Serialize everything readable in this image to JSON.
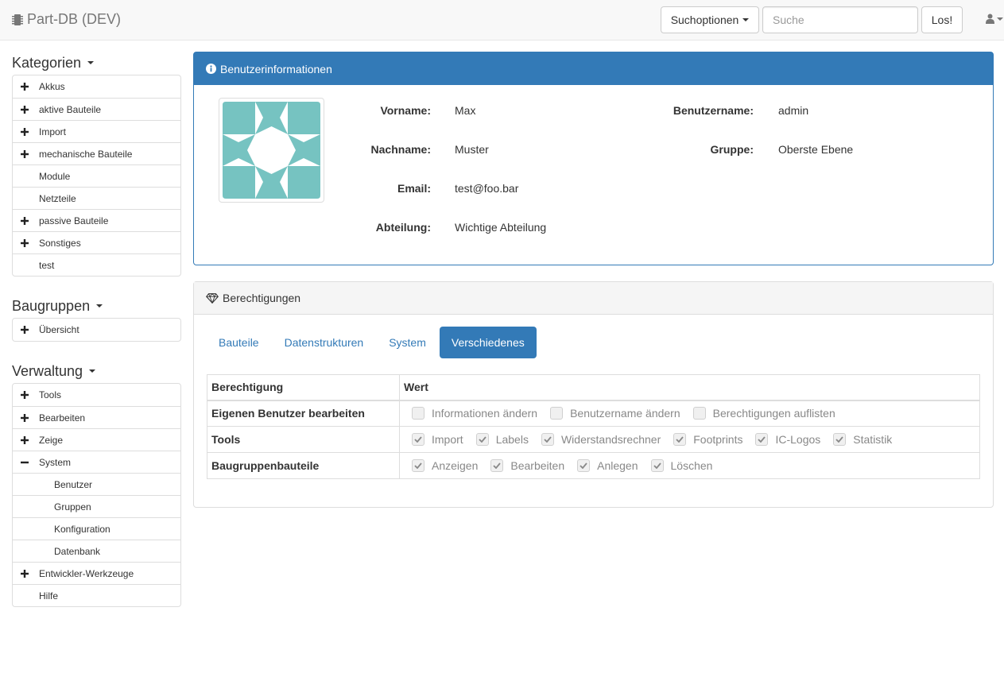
{
  "navbar": {
    "brand": "Part-DB (DEV)",
    "search_options_label": "Suchoptionen",
    "search_placeholder": "Suche",
    "search_value": "",
    "go_label": "Los!"
  },
  "sidebar": {
    "categories": {
      "heading": "Kategorien",
      "items": [
        {
          "label": "Akkus",
          "expandable": true
        },
        {
          "label": "aktive Bauteile",
          "expandable": true
        },
        {
          "label": "Import",
          "expandable": true
        },
        {
          "label": "mechanische Bauteile",
          "expandable": true
        },
        {
          "label": "Module",
          "expandable": false
        },
        {
          "label": "Netzteile",
          "expandable": false
        },
        {
          "label": "passive Bauteile",
          "expandable": true
        },
        {
          "label": "Sonstiges",
          "expandable": true
        },
        {
          "label": "test",
          "expandable": false
        }
      ]
    },
    "assemblies": {
      "heading": "Baugruppen",
      "items": [
        {
          "label": "Übersicht",
          "expandable": true
        }
      ]
    },
    "admin": {
      "heading": "Verwaltung",
      "items": [
        {
          "label": "Tools",
          "expandable": true
        },
        {
          "label": "Bearbeiten",
          "expandable": true
        },
        {
          "label": "Zeige",
          "expandable": true
        },
        {
          "label": "System",
          "expandable": true,
          "expanded": true
        },
        {
          "label": "Benutzer",
          "child": true
        },
        {
          "label": "Gruppen",
          "child": true
        },
        {
          "label": "Konfiguration",
          "child": true
        },
        {
          "label": "Datenbank",
          "child": true
        },
        {
          "label": "Entwickler-Werkzeuge",
          "expandable": true
        },
        {
          "label": "Hilfe",
          "expandable": false
        }
      ]
    }
  },
  "user_info": {
    "title": "Benutzerinformationen",
    "first_name_label": "Vorname:",
    "first_name": "Max",
    "last_name_label": "Nachname:",
    "last_name": "Muster",
    "email_label": "Email:",
    "email": "test@foo.bar",
    "department_label": "Abteilung:",
    "department": "Wichtige Abteilung",
    "username_label": "Benutzername:",
    "username": "admin",
    "group_label": "Gruppe:",
    "group": "Oberste Ebene"
  },
  "permissions": {
    "title": "Berechtigungen",
    "tabs": [
      "Bauteile",
      "Datenstrukturen",
      "System",
      "Verschiedenes"
    ],
    "active_tab": "Verschiedenes",
    "columns": [
      "Berechtigung",
      "Wert"
    ],
    "rows": [
      {
        "name": "Eigenen Benutzer bearbeiten",
        "options": [
          {
            "label": "Informationen ändern",
            "checked": false
          },
          {
            "label": "Benutzername ändern",
            "checked": false
          },
          {
            "label": "Berechtigungen auflisten",
            "checked": false
          }
        ]
      },
      {
        "name": "Tools",
        "options": [
          {
            "label": "Import",
            "checked": true
          },
          {
            "label": "Labels",
            "checked": true
          },
          {
            "label": "Widerstandsrechner",
            "checked": true
          },
          {
            "label": "Footprints",
            "checked": true
          },
          {
            "label": "IC-Logos",
            "checked": true
          },
          {
            "label": "Statistik",
            "checked": true
          }
        ]
      },
      {
        "name": "Baugruppenbauteile",
        "options": [
          {
            "label": "Anzeigen",
            "checked": true
          },
          {
            "label": "Bearbeiten",
            "checked": true
          },
          {
            "label": "Anlegen",
            "checked": true
          },
          {
            "label": "Löschen",
            "checked": true
          }
        ]
      }
    ]
  },
  "colors": {
    "primary": "#337ab7",
    "avatar": "#76c3c1"
  }
}
